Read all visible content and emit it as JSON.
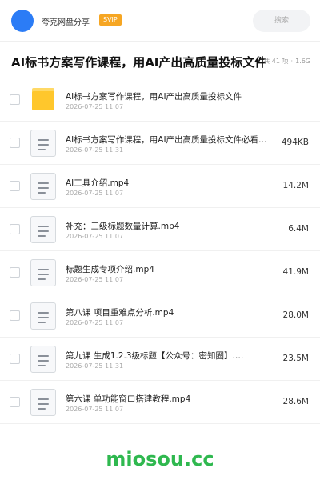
{
  "header": {
    "app_name": "夸克网盘分享",
    "badge": "SVIP",
    "search_placeholder": "搜索"
  },
  "title": {
    "text": "AI标书方案写作课程，用AI产出高质量投标文件",
    "count": "共 41 项",
    "separator": "·",
    "total_size": "1.6G"
  },
  "files": [
    {
      "type": "folder",
      "name": "AI标书方案写作课程，用AI产出高质量投标文件",
      "date": "2026-07-25 11:07",
      "size": ""
    },
    {
      "type": "file",
      "name": "AI标书方案写作课程，用AI产出高质量投标文件必看…",
      "date": "2026-07-25 11:31",
      "size": "494KB"
    },
    {
      "type": "file",
      "name": "AI工具介绍.mp4",
      "date": "2026-07-25 11:07",
      "size": "14.2M"
    },
    {
      "type": "file",
      "name": "补充：三级标题数量计算.mp4",
      "date": "2026-07-25 11:07",
      "size": "6.4M"
    },
    {
      "type": "file",
      "name": "标题生成专项介绍.mp4",
      "date": "2026-07-25 11:07",
      "size": "41.9M"
    },
    {
      "type": "file",
      "name": "第八课   项目重难点分析.mp4",
      "date": "2026-07-25 11:07",
      "size": "28.0M"
    },
    {
      "type": "file",
      "name": "第九课   生成1.2.3级标题【公众号：密知圈】.…",
      "date": "2026-07-25 11:31",
      "size": "23.5M"
    },
    {
      "type": "file",
      "name": "第六课   单功能窗口搭建教程.mp4",
      "date": "2026-07-25 11:07",
      "size": "28.6M"
    }
  ],
  "footer": {
    "watermark": "miosou.cc"
  },
  "colors": {
    "accent": "#2b7cf6",
    "svip": "#f6a623",
    "folder": "#ffc72c",
    "watermark": "#2fb84f"
  },
  "icons": {
    "folder": "folder-icon",
    "file": "file-icon"
  }
}
